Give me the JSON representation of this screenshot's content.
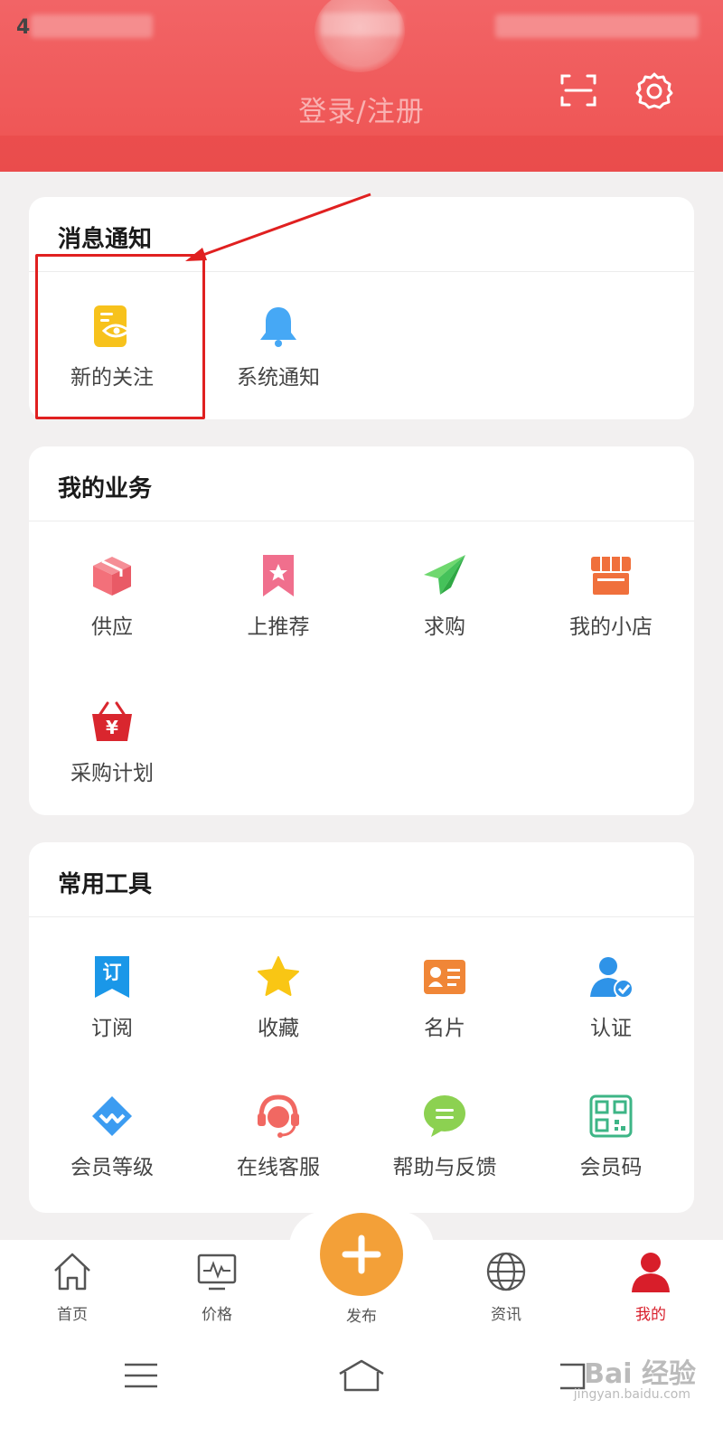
{
  "header": {
    "status_left": "4",
    "login_label": "登录/注册",
    "scan_icon": "scan-icon",
    "settings_icon": "gear-icon"
  },
  "notifications": {
    "title": "消息通知",
    "items": [
      {
        "label": "新的关注",
        "icon": "new-follow-icon",
        "color": "#f7c21c"
      },
      {
        "label": "系统通知",
        "icon": "bell-icon",
        "color": "#46a8f5"
      }
    ]
  },
  "business": {
    "title": "我的业务",
    "items": [
      {
        "label": "供应",
        "icon": "box-icon",
        "color": "#f3707a"
      },
      {
        "label": "上推荐",
        "icon": "bookmark-star-icon",
        "color": "#f06f8d"
      },
      {
        "label": "求购",
        "icon": "paper-plane-icon",
        "color": "#45c25a"
      },
      {
        "label": "我的小店",
        "icon": "shop-icon",
        "color": "#f0703c"
      },
      {
        "label": "采购计划",
        "icon": "basket-icon",
        "color": "#d9262e"
      }
    ]
  },
  "tools": {
    "title": "常用工具",
    "items": [
      {
        "label": "订阅",
        "icon": "subscribe-icon",
        "color": "#1a97e8"
      },
      {
        "label": "收藏",
        "icon": "star-icon",
        "color": "#f9c614"
      },
      {
        "label": "名片",
        "icon": "business-card-icon",
        "color": "#f08637"
      },
      {
        "label": "认证",
        "icon": "verified-user-icon",
        "color": "#2e93e8"
      },
      {
        "label": "会员等级",
        "icon": "diamond-icon",
        "color": "#3c9cf1"
      },
      {
        "label": "在线客服",
        "icon": "customer-service-icon",
        "color": "#f16862"
      },
      {
        "label": "帮助与反馈",
        "icon": "chat-bubble-icon",
        "color": "#8cd151"
      },
      {
        "label": "会员码",
        "icon": "qr-code-icon",
        "color": "#3db586"
      }
    ],
    "subscribe_glyph": "订"
  },
  "tabbar": {
    "items": [
      {
        "label": "首页",
        "icon": "home-icon"
      },
      {
        "label": "价格",
        "icon": "price-chart-icon"
      },
      {
        "label": "发布",
        "icon": "plus-icon"
      },
      {
        "label": "资讯",
        "icon": "globe-icon"
      },
      {
        "label": "我的",
        "icon": "user-icon",
        "active": true
      }
    ]
  },
  "watermark": {
    "text": "Bai 经验",
    "sub": "jingyan.baidu.com"
  },
  "colors": {
    "header": "#f26466",
    "accent": "#d81e2a",
    "publish": "#f3a038",
    "annotation": "#e02020"
  }
}
